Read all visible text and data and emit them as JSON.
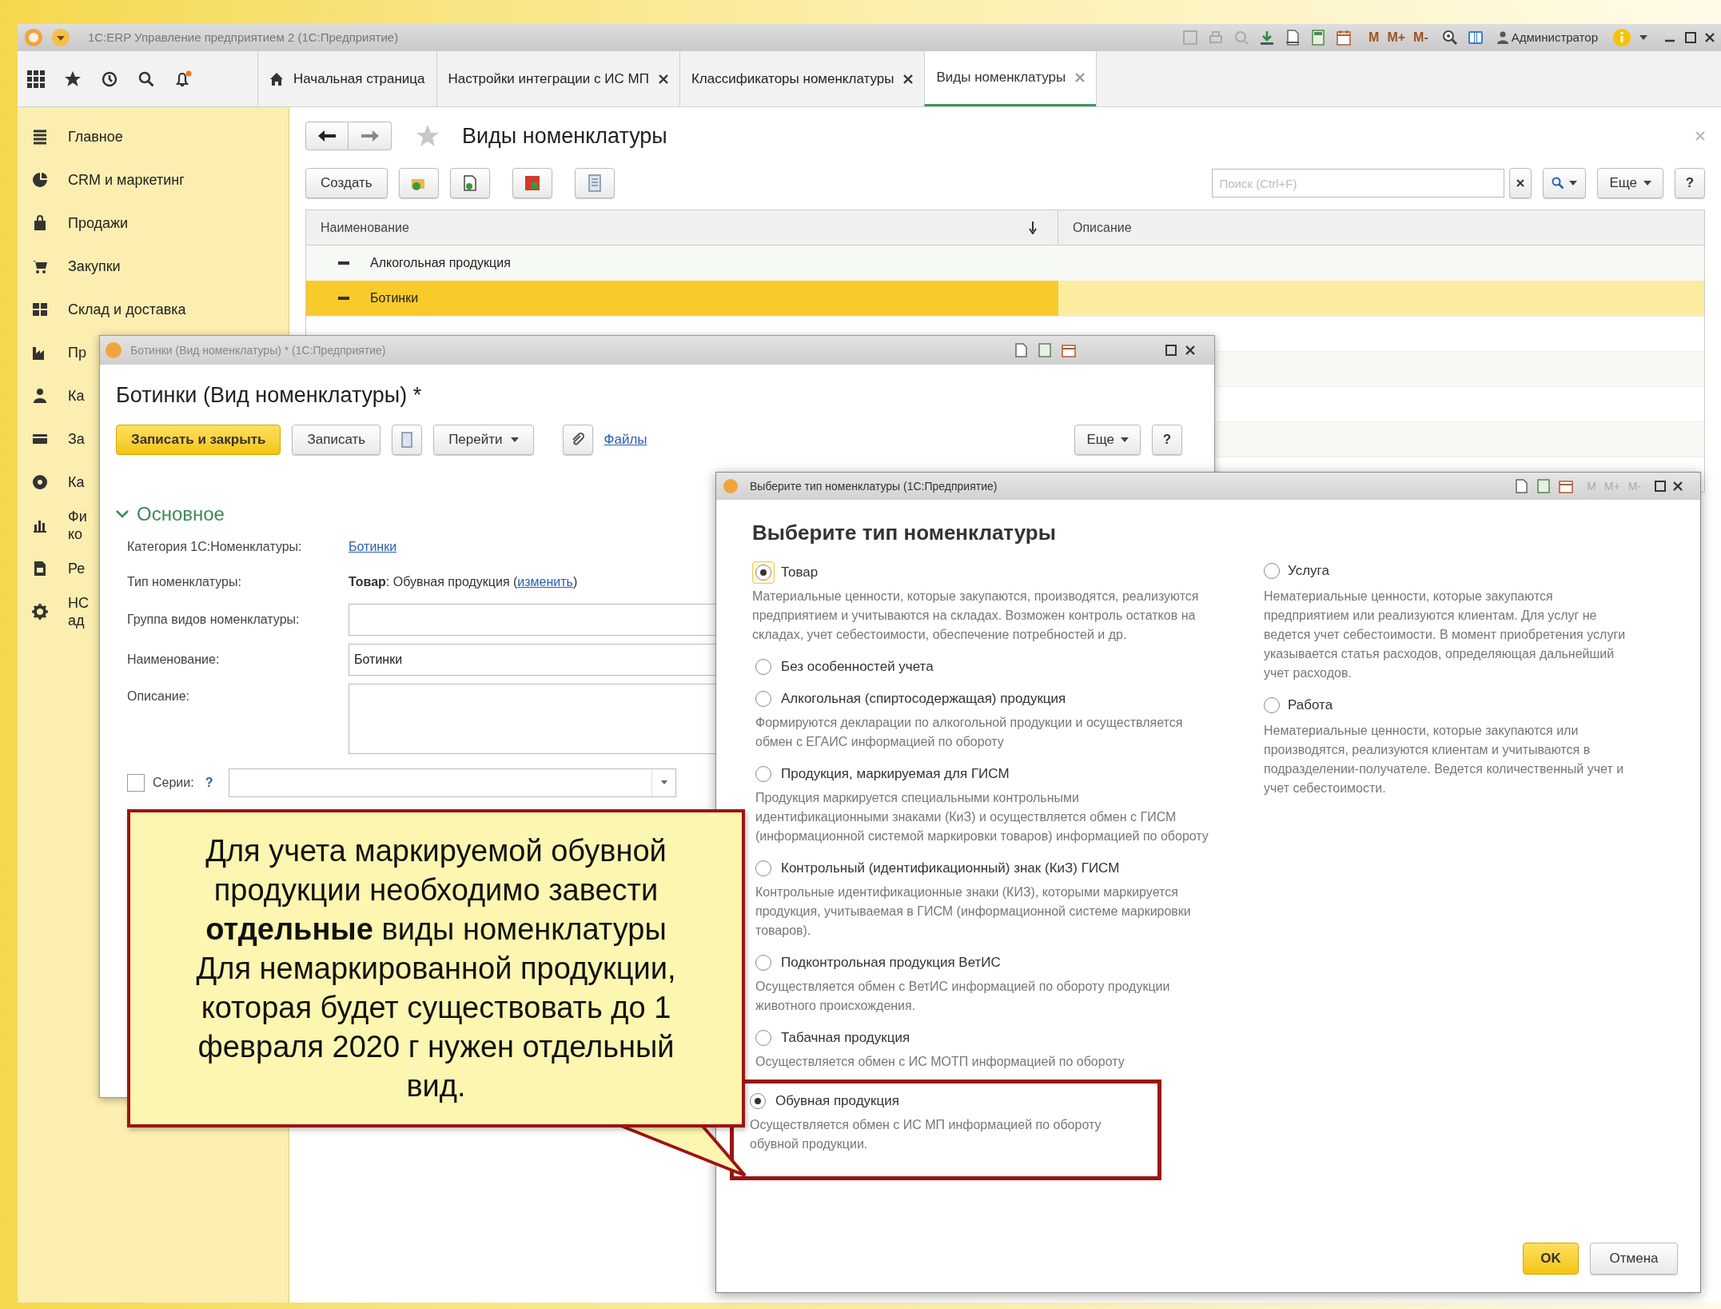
{
  "app_window": {
    "title": "1С:ERP Управление предприятием 2 (1С:Предприятие)",
    "memory_buttons": [
      "M",
      "M+",
      "M-"
    ],
    "user": "Администратор"
  },
  "tabs": [
    {
      "label": "Начальная страница",
      "kind": "home",
      "selected": false
    },
    {
      "label": "Настройки интеграции с ИС МП",
      "kind": "closable",
      "selected": false
    },
    {
      "label": "Классификаторы номенклатуры",
      "kind": "closable",
      "selected": false
    },
    {
      "label": "Виды номенклатуры",
      "kind": "closable",
      "selected": true
    }
  ],
  "sidebar": {
    "items": [
      {
        "lines": [
          "Главное"
        ]
      },
      {
        "lines": [
          "CRM и маркетинг"
        ]
      },
      {
        "lines": [
          "Продажи"
        ]
      },
      {
        "lines": [
          "Закупки"
        ]
      },
      {
        "lines": [
          "Склад и доставка"
        ]
      },
      {
        "lines": [
          "Пр"
        ]
      },
      {
        "lines": [
          "Ка"
        ]
      },
      {
        "lines": [
          "За"
        ]
      },
      {
        "lines": [
          "Ка"
        ]
      },
      {
        "lines": [
          "Фи",
          "ко"
        ]
      },
      {
        "lines": [
          "Ре"
        ]
      },
      {
        "lines": [
          "НС",
          "ад"
        ]
      }
    ]
  },
  "list_form": {
    "title": "Виды номенклатуры",
    "create_button": "Создать",
    "search": {
      "placeholder": "Поиск (Ctrl+F)"
    },
    "more_button": "Еще",
    "help_button": "?",
    "table": {
      "columns": [
        "Наименование",
        "Описание"
      ],
      "rows": [
        {
          "name": "Алкогольная продукция",
          "selected": false
        },
        {
          "name": "Ботинки",
          "selected": true
        }
      ]
    }
  },
  "item_window": {
    "window_title": "Ботинки (Вид номенклатуры) * (1С:Предприятие)",
    "title": "Ботинки (Вид номенклатуры) *",
    "save_close_button": "Записать и закрыть",
    "save_button": "Записать",
    "goto_button": "Перейти",
    "files_link": "Файлы",
    "more_button": "Еще",
    "help_button": "?",
    "section": {
      "title": "Основное",
      "expanded": true
    },
    "fields": [
      {
        "kind": "link",
        "label": "Категория 1С:Номенклатуры:",
        "value": "Ботинки"
      },
      {
        "kind": "type",
        "label": "Тип номенклатуры:",
        "value": "**Товар**: Обувная продукция (",
        "link": "изменить",
        "suffix": ")"
      },
      {
        "kind": "input",
        "label": "Группа видов номенклатуры:"
      },
      {
        "kind": "input",
        "label": "Наименование:",
        "value": "Ботинки"
      },
      {
        "kind": "textarea",
        "label": "Описание:"
      },
      {
        "kind": "checkbox",
        "label": "Серии:",
        "checked": false,
        "help": "?"
      }
    ]
  },
  "type_dialog": {
    "window_title": "Выберите тип номенклатуры (1С:Предприятие)",
    "memory_buttons": [
      "M",
      "M+",
      "M-"
    ],
    "title": "Выберите тип номенклатуры",
    "goods": {
      "label": "Товар",
      "selected": true,
      "description": "Материальные ценности, которые закупаются, производятся, реализуются предприятием и учитываются на складах. Возможен контроль остатков на складах, учет себестоимости, обеспечение потребностей и др.",
      "subtypes": [
        {
          "label": "Без особенностей учета",
          "selected": false,
          "highlighted": false
        },
        {
          "label": "Алкогольная (спиртосодержащая) продукция",
          "description": "Формируются декларации по алкогольной продукции и осуществляется обмен с ЕГАИС информацией по обороту",
          "selected": false,
          "highlighted": false
        },
        {
          "label": "Продукция, маркируемая для ГИСМ",
          "description": "Продукция маркируется специальными контрольными идентификационными знаками (КиЗ) и осуществляется обмен с ГИСМ (информационной системой маркировки товаров) информацией по обороту",
          "selected": false,
          "highlighted": false
        },
        {
          "label": "Контрольный (идентификационный) знак (КиЗ) ГИСМ",
          "description": "Контрольные идентификационные знаки (КИЗ), которыми маркируется продукция, учитываемая в ГИСМ (информационной системе маркировки товаров).",
          "selected": false,
          "highlighted": false
        },
        {
          "label": "Подконтрольная продукция ВетИС",
          "description": "Осуществляется обмен с ВетИС информацией по обороту продукции животного происхождения.",
          "selected": false,
          "highlighted": false
        },
        {
          "label": "Табачная продукция",
          "description": "Осуществляется обмен с ИС МОТП информацией по обороту",
          "selected": false,
          "highlighted": false
        },
        {
          "label": "Обувная продукция",
          "description": "Осуществляется обмен с ИС МП информацией по обороту обувной продукции.",
          "selected": true,
          "highlighted": true
        }
      ]
    },
    "other_types": [
      {
        "label": "Услуга",
        "selected": false,
        "description": "Нематериальные ценности, которые закупаются предприятием или реализуются клиентам. Для услуг не ведется учет себестоимости. В момент приобретения услуги указывается статья расходов, определяющая дальнейший учет расходов."
      },
      {
        "label": "Работа",
        "selected": false,
        "description": "Нематериальные ценности, которые закупаются или производятся, реализуются клиентам и учитываются в подразделении-получателе. Ведется количественный учет и учет себестоимости."
      }
    ],
    "ok_button": "OK",
    "cancel_button": "Отмена"
  },
  "callout": {
    "lines": [
      "Для учета маркируемой обувной",
      "продукции необходимо завести",
      "**отдельные** виды номенклатуры",
      "Для немаркированной продукции,",
      "которая будет существовать до 1",
      "февраля 2020 г нужен отдельный",
      "вид."
    ]
  }
}
